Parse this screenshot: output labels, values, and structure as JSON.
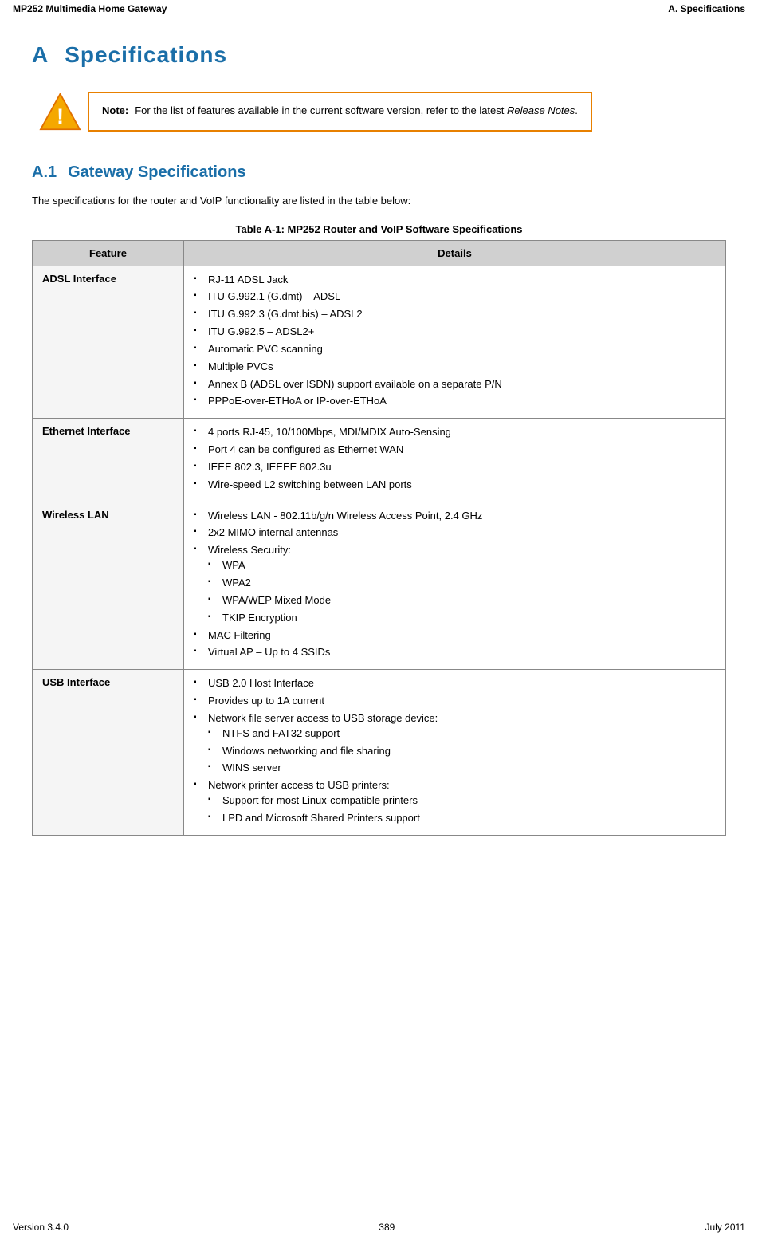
{
  "header": {
    "left": "MP252 Multimedia Home Gateway",
    "right": "A. Specifications"
  },
  "footer": {
    "left": "Version 3.4.0",
    "center": "389",
    "right": "July 2011"
  },
  "chapter": {
    "letter": "A",
    "title": "Specifications"
  },
  "note": {
    "label": "Note:",
    "text": "For the list of features available in the current software version, refer to the latest ",
    "italic": "Release Notes",
    "text_end": "."
  },
  "section": {
    "number": "A.1",
    "title": "Gateway Specifications",
    "intro": "The specifications for the router and VoIP functionality are listed in the table below:"
  },
  "table": {
    "title": "Table A-1: MP252 Router and VoIP Software Specifications",
    "col_feature": "Feature",
    "col_details": "Details",
    "rows": [
      {
        "feature": "ADSL Interface",
        "details": [
          "RJ-11 ADSL Jack",
          "ITU G.992.1 (G.dmt) – ADSL",
          "ITU G.992.3 (G.dmt.bis) – ADSL2",
          "ITU G.992.5 – ADSL2+",
          "Automatic PVC scanning",
          "Multiple PVCs",
          "Annex B (ADSL over ISDN) support available on a separate P/N",
          "PPPoE-over-ETHoA or IP-over-ETHoA"
        ],
        "sub": []
      },
      {
        "feature": "Ethernet Interface",
        "details": [
          "4 ports RJ-45, 10/100Mbps, MDI/MDIX Auto-Sensing",
          "Port 4 can be configured as Ethernet WAN",
          "IEEE 802.3, IEEEE 802.3u",
          "Wire-speed L2 switching between LAN ports"
        ],
        "sub": []
      },
      {
        "feature": "Wireless LAN",
        "details_structured": [
          {
            "text": "Wireless LAN - 802.11b/g/n Wireless Access Point, 2.4 GHz",
            "sub": []
          },
          {
            "text": "2x2 MIMO internal antennas",
            "sub": []
          },
          {
            "text": "Wireless Security:",
            "sub": [
              "WPA",
              "WPA2",
              "WPA/WEP Mixed Mode",
              "TKIP Encryption"
            ]
          },
          {
            "text": "MAC Filtering",
            "sub": []
          },
          {
            "text": "Virtual AP – Up to 4 SSIDs",
            "sub": []
          }
        ]
      },
      {
        "feature": "USB Interface",
        "details_structured": [
          {
            "text": "USB 2.0 Host Interface",
            "sub": []
          },
          {
            "text": "Provides up to 1A current",
            "sub": []
          },
          {
            "text": "Network file server access to USB storage device:",
            "sub": [
              "NTFS and FAT32 support",
              "Windows networking and file sharing",
              "WINS server"
            ]
          },
          {
            "text": "Network printer access to USB printers:",
            "sub": [
              "Support for most Linux-compatible printers",
              "LPD and Microsoft Shared Printers support"
            ]
          }
        ]
      }
    ]
  }
}
